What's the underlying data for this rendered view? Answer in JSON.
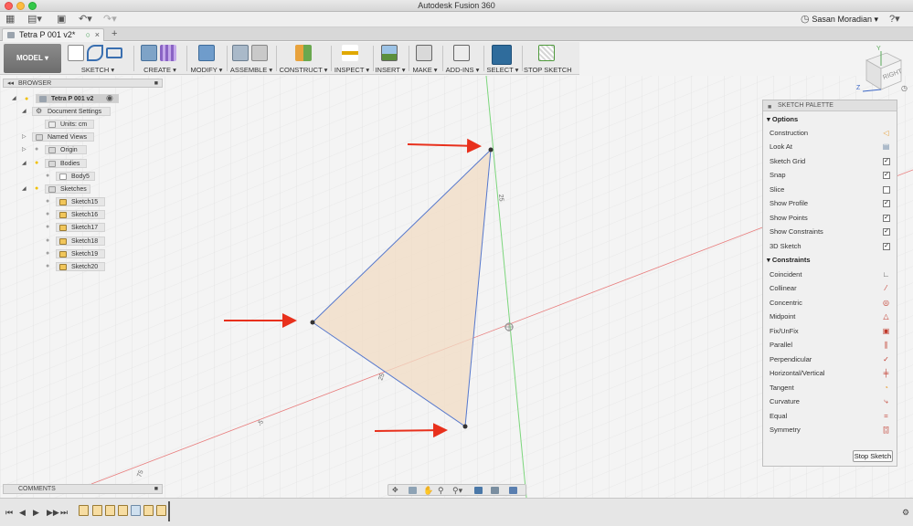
{
  "app": {
    "title": "Autodesk Fusion 360"
  },
  "user": {
    "name": "Sasan Moradian"
  },
  "document_tab": {
    "label": "Tetra P 001 v2*"
  },
  "workspace": {
    "label": "MODEL"
  },
  "ribbon": {
    "groups": [
      {
        "label": "SKETCH ▾"
      },
      {
        "label": "CREATE ▾"
      },
      {
        "label": "MODIFY ▾"
      },
      {
        "label": "ASSEMBLE ▾"
      },
      {
        "label": "CONSTRUCT ▾"
      },
      {
        "label": "INSPECT ▾"
      },
      {
        "label": "INSERT ▾"
      },
      {
        "label": "MAKE ▾"
      },
      {
        "label": "ADD-INS ▾"
      },
      {
        "label": "SELECT ▾"
      },
      {
        "label": "STOP SKETCH"
      }
    ]
  },
  "browser": {
    "title": "BROWSER",
    "root": "Tetra P 001 v2",
    "items": [
      {
        "label": "Document Settings"
      },
      {
        "label": "Units: cm"
      },
      {
        "label": "Named Views"
      },
      {
        "label": "Origin"
      },
      {
        "label": "Bodies"
      },
      {
        "label": "Body5"
      },
      {
        "label": "Sketches"
      },
      {
        "label": "Sketch15"
      },
      {
        "label": "Sketch16"
      },
      {
        "label": "Sketch17"
      },
      {
        "label": "Sketch18"
      },
      {
        "label": "Sketch19"
      },
      {
        "label": "Sketch20"
      }
    ]
  },
  "palette": {
    "title": "SKETCH PALETTE",
    "options_title": "Options",
    "options": [
      {
        "label": "Construction",
        "check": ""
      },
      {
        "label": "Look At",
        "check": ""
      },
      {
        "label": "Sketch Grid",
        "check": "✓"
      },
      {
        "label": "Snap",
        "check": "✓"
      },
      {
        "label": "Slice",
        "check": ""
      },
      {
        "label": "Show Profile",
        "check": "✓"
      },
      {
        "label": "Show Points",
        "check": "✓"
      },
      {
        "label": "Show Constraints",
        "check": "✓"
      },
      {
        "label": "3D Sketch",
        "check": "✓"
      }
    ],
    "constraints_title": "Constraints",
    "constraints": [
      {
        "label": "Coincident"
      },
      {
        "label": "Collinear"
      },
      {
        "label": "Concentric"
      },
      {
        "label": "Midpoint"
      },
      {
        "label": "Fix/UnFix"
      },
      {
        "label": "Parallel"
      },
      {
        "label": "Perpendicular"
      },
      {
        "label": "Horizontal/Vertical"
      },
      {
        "label": "Tangent"
      },
      {
        "label": "Curvature"
      },
      {
        "label": "Equal"
      },
      {
        "label": "Symmetry"
      }
    ],
    "stop_button": "Stop Sketch"
  },
  "viewcube": {
    "face": "RIGHT",
    "axis_z": "Z",
    "axis_y": "Y"
  },
  "canvas": {
    "dim_labels": [
      "25",
      "25",
      "-5",
      "75"
    ]
  },
  "comments": {
    "title": "COMMENTS"
  },
  "colors": {
    "accent_select": "#2f6c9c",
    "annotation_arrow": "#e8301c",
    "profile_fill": "#f2dcc4",
    "sketch_line": "#5577cc"
  }
}
